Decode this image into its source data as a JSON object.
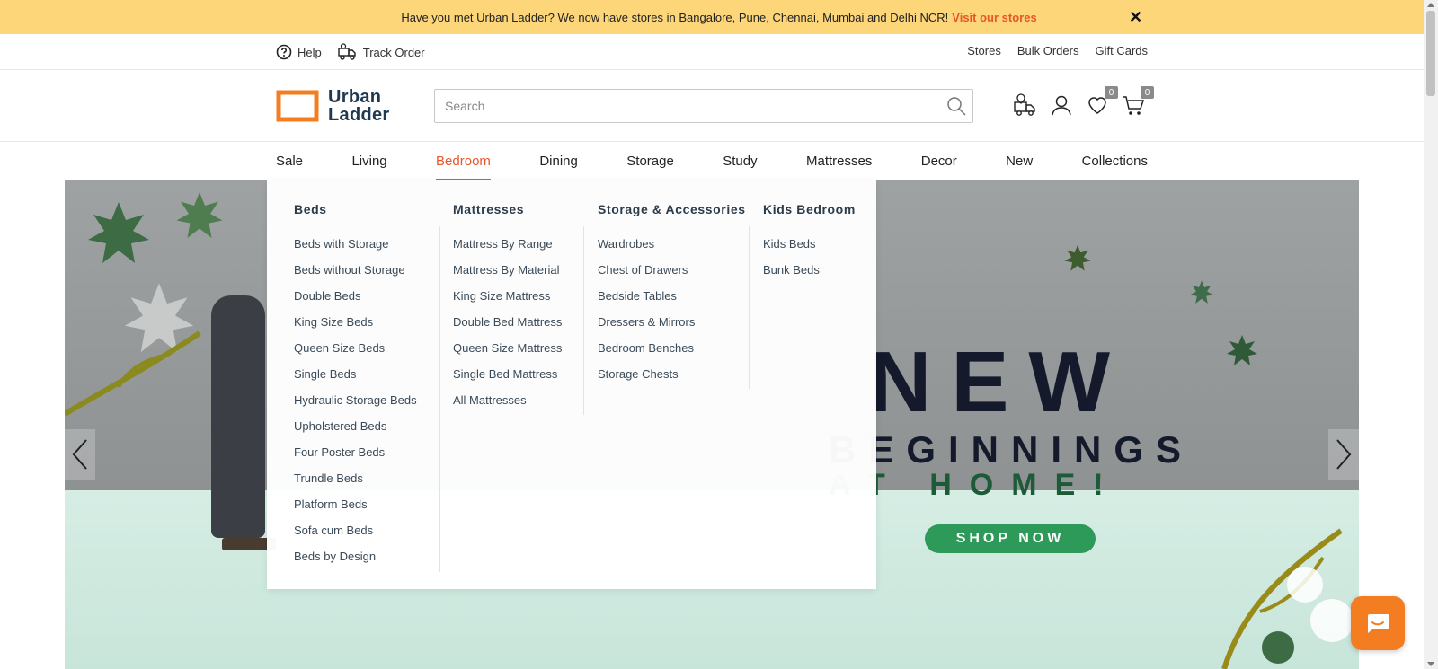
{
  "announcement": {
    "text": "Have you met Urban Ladder? We now have stores in Bangalore, Pune, Chennai, Mumbai and Delhi NCR!",
    "link": "Visit our stores",
    "close": "✕"
  },
  "utility": {
    "help": "Help",
    "track_order": "Track Order",
    "right": [
      "Stores",
      "Bulk Orders",
      "Gift Cards"
    ]
  },
  "header": {
    "logo_line1": "Urban",
    "logo_line2": "Ladder",
    "search_placeholder": "Search",
    "wishlist_count": "0",
    "cart_count": "0",
    "brand_color": "#f47d22"
  },
  "nav": {
    "items": [
      "Sale",
      "Living",
      "Bedroom",
      "Dining",
      "Storage",
      "Study",
      "Mattresses",
      "Decor",
      "New",
      "Collections"
    ],
    "active": "Bedroom",
    "active_color": "#e8562a"
  },
  "mega_menu": {
    "columns": [
      {
        "title": "Beds",
        "items": [
          "Beds with Storage",
          "Beds without Storage",
          "Double Beds",
          "King Size Beds",
          "Queen Size Beds",
          "Single Beds",
          "Hydraulic Storage Beds",
          "Upholstered Beds",
          "Four Poster Beds",
          "Trundle Beds",
          "Platform Beds",
          "Sofa cum Beds",
          "Beds by Design"
        ]
      },
      {
        "title": "Mattresses",
        "items": [
          "Mattress By Range",
          "Mattress By Material",
          "King Size Mattress",
          "Double Bed Mattress",
          "Queen Size Mattress",
          "Single Bed Mattress",
          "All Mattresses"
        ]
      },
      {
        "title": "Storage & Accessories",
        "items": [
          "Wardrobes",
          "Chest of Drawers",
          "Bedside Tables",
          "Dressers & Mirrors",
          "Bedroom Benches",
          "Storage Chests"
        ]
      },
      {
        "title": "Kids Bedroom",
        "items": [
          "Kids Beds",
          "Bunk Beds"
        ]
      }
    ]
  },
  "banner": {
    "line1": "NEW",
    "line2": "BEGINNINGS",
    "line3": "AT HOME!",
    "cta": "SHOP NOW"
  }
}
